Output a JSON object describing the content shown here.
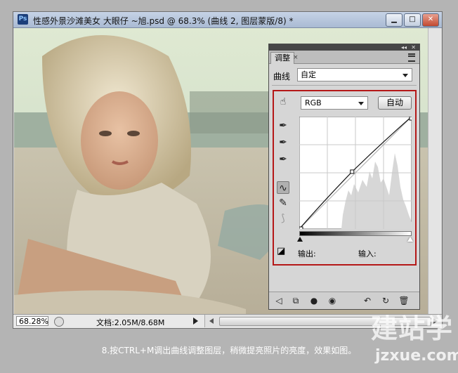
{
  "window": {
    "app_icon": "Ps",
    "title": "性感外景沙滩美女  大眼仔 ~旭.psd @ 68.3% (曲线 2, 图层蒙版/8) *",
    "controls": {
      "minimize": "▁",
      "maximize": "□",
      "close": "✕"
    }
  },
  "status": {
    "zoom": "68.28%",
    "doc_info": "文档:2.05M/8.68M"
  },
  "panel": {
    "collapse_glyph": "◂◂",
    "close_glyph": "✕",
    "tab_label": "调整",
    "tab_close": "×",
    "adjustment_label": "曲线",
    "preset_value": "自定",
    "channel_value": "RGB",
    "auto_button": "自动",
    "output_label": "输出:",
    "input_label": "输入:",
    "icons": {
      "hand_adjust": "pointing-hand-icon",
      "black_point": "eyedropper-black-icon",
      "gray_point": "eyedropper-gray-icon",
      "white_point": "eyedropper-white-icon",
      "curve_tool": "curve-edit-icon",
      "pencil_tool": "pencil-icon",
      "smooth_tool": "smooth-icon",
      "clipping_warning": "clipping-warning-icon"
    },
    "bottom_icons": [
      "back-arrow-icon",
      "expand-view-icon",
      "clip-layer-icon",
      "visibility-eye-icon",
      "view-previous-icon",
      "reset-icon",
      "trash-icon"
    ]
  },
  "curve": {
    "input_range": [
      0,
      255
    ],
    "output_range": [
      0,
      255
    ],
    "points": [
      [
        0,
        0
      ],
      [
        120,
        130
      ],
      [
        255,
        255
      ]
    ]
  },
  "colors": {
    "highlight_border": "#b51818",
    "titlebar": "#b5c4db"
  },
  "caption": "8.按CTRL+M调出曲线调整图层，稍微提亮照片的亮度，效果如图。",
  "watermark": {
    "text": "建站学",
    "url": "jzxue.com"
  }
}
